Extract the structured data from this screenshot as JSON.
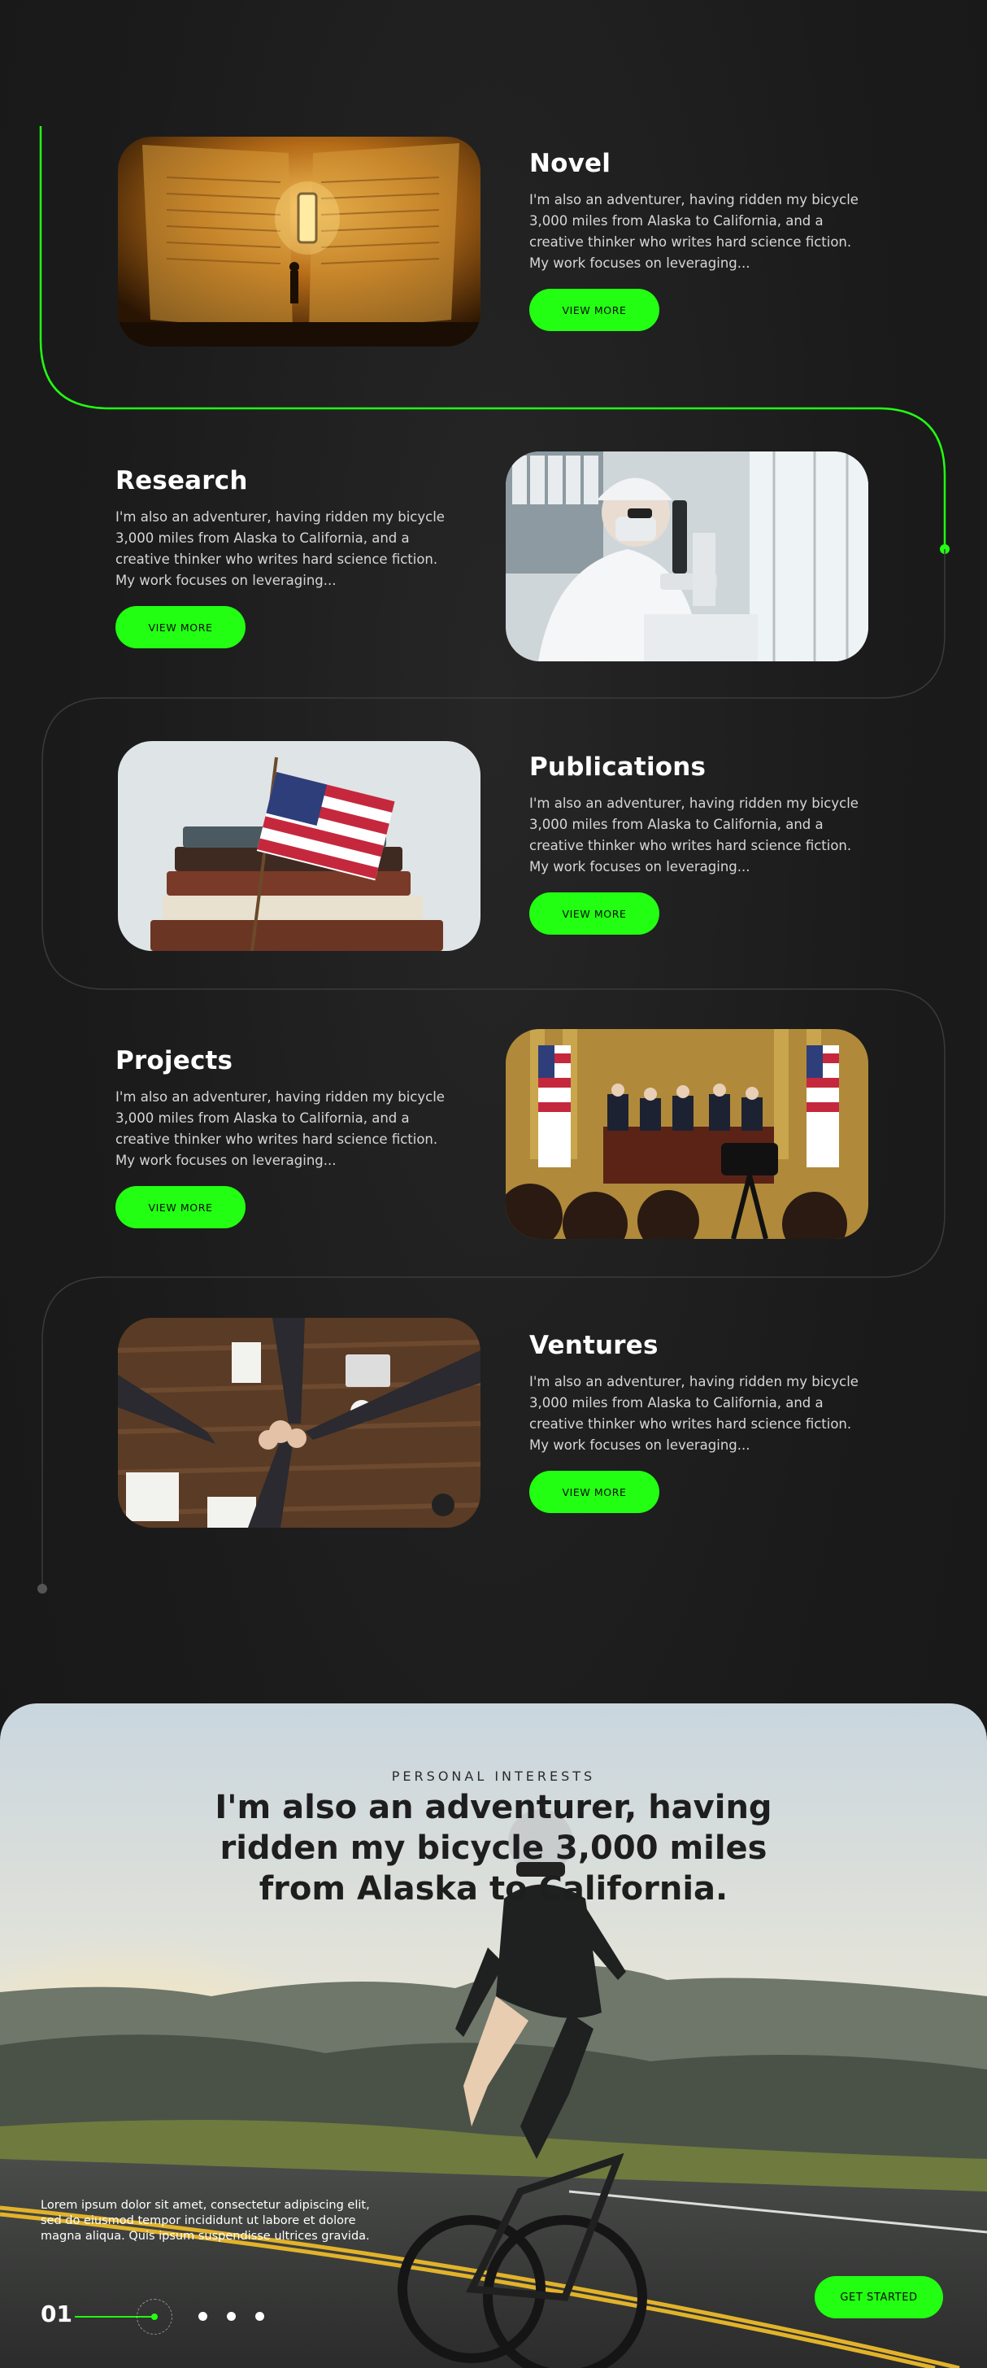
{
  "theme": {
    "accent": "#22ff12",
    "background": "#1b1b1b"
  },
  "sections": [
    {
      "title": "Novel",
      "description": "I'm also an adventurer, having ridden my bicycle 3,000 miles from Alaska to California, and a creative thinker who writes hard science fiction. My work focuses on leveraging...",
      "button": "VIEW MORE",
      "image": "open book with tiny figure and lantern"
    },
    {
      "title": "Research",
      "description": "I'm also an adventurer, having ridden my bicycle 3,000 miles from Alaska to California, and a creative thinker who writes hard science fiction. My work focuses on leveraging...",
      "button": "VIEW MORE",
      "image": "scientist at microscope"
    },
    {
      "title": "Publications",
      "description": "I'm also an adventurer, having ridden my bicycle 3,000 miles from Alaska to California, and a creative thinker who writes hard science fiction. My work focuses on leveraging...",
      "button": "VIEW MORE",
      "image": "stack of books with american flag"
    },
    {
      "title": "Projects",
      "description": "I'm also an adventurer, having ridden my bicycle 3,000 miles from Alaska to California, and a creative thinker who writes hard science fiction. My work focuses on leveraging...",
      "button": "VIEW MORE",
      "image": "press conference with flags and camera"
    },
    {
      "title": "Ventures",
      "description": "I'm also an adventurer, having ridden my bicycle 3,000 miles from Alaska to California, and a creative thinker who writes hard science fiction. My work focuses on leveraging...",
      "button": "VIEW MORE",
      "image": "team hands together over table"
    }
  ],
  "hero": {
    "eyebrow": "PERSONAL INTERESTS",
    "headline": "I'm also an adventurer, having ridden my bicycle 3,000 miles from Alaska to California.",
    "body": "Lorem ipsum dolor sit amet, consectetur adipiscing elit, sed do eiusmod tempor incididunt ut labore et dolore magna aliqua. Quis ipsum suspendisse ultrices gravida.",
    "slide_number": "01",
    "cta": "GET STARTED",
    "image": "cyclist on mountain road at sunset"
  }
}
